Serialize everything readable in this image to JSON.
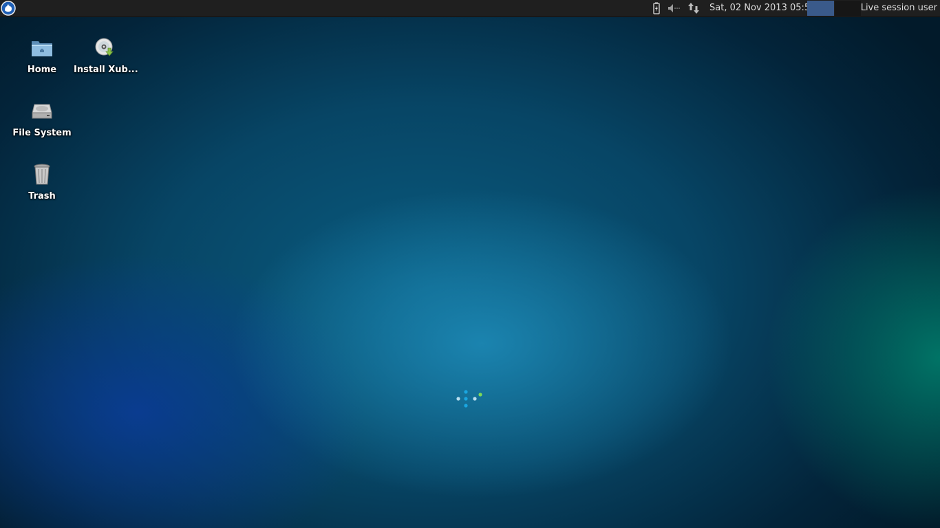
{
  "panel": {
    "clock": "Sat, 02 Nov 2013 05:59",
    "user": "Live session user",
    "workspaces": [
      "workspace-1",
      "workspace-2"
    ],
    "icons": [
      "xfce-menu-icon",
      "battery-icon",
      "volume-muted-icon",
      "network-icon"
    ]
  },
  "desktop": {
    "icons": [
      {
        "label": "Home",
        "icon": "home-folder-icon"
      },
      {
        "label": "Install Xub...",
        "icon": "install-disc-icon"
      },
      {
        "label": "File System",
        "icon": "hard-drive-icon"
      },
      {
        "label": "Trash",
        "icon": "trash-icon"
      }
    ]
  },
  "colors": {
    "panel_bg": "#1f1f1f",
    "active_workspace": "#3a5a8a",
    "wallpaper_center": "#1e8cb9"
  }
}
